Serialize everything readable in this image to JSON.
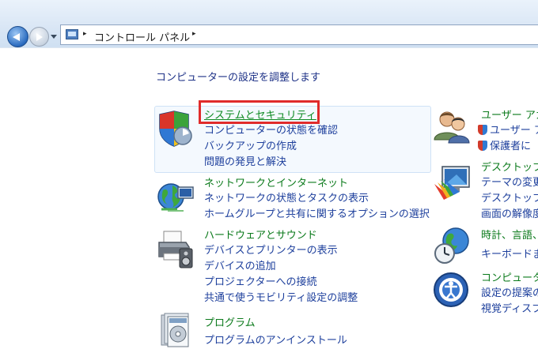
{
  "window": {
    "breadcrumb": "コントロール パネル",
    "breadcrumb_sep": "▸"
  },
  "main": {
    "heading": "コンピューターの設定を調整します",
    "left_categories": [
      {
        "title": "システムとセキュリティ",
        "icon": "shield-icon",
        "links": [
          "コンピューターの状態を確認",
          "バックアップの作成",
          "問題の発見と解決"
        ]
      },
      {
        "title": "ネットワークとインターネット",
        "icon": "network-globe-icon",
        "links": [
          "ネットワークの状態とタスクの表示",
          "ホームグループと共有に関するオプションの選択"
        ]
      },
      {
        "title": "ハードウェアとサウンド",
        "icon": "printer-icon",
        "links": [
          "デバイスとプリンターの表示",
          "デバイスの追加",
          "プロジェクターへの接続",
          "共通で使うモビリティ設定の調整"
        ]
      },
      {
        "title": "プログラム",
        "icon": "programs-icon",
        "links": [
          "プログラムのアンインストール"
        ]
      }
    ],
    "right_categories": [
      {
        "title": "ユーザー アカ",
        "icon": "users-icon",
        "links": [
          "ユーザー ア",
          "保護者に"
        ]
      },
      {
        "title": "デスクトップ",
        "icon": "desktop-icon",
        "links": [
          "テーマの変更",
          "デスクトップ",
          "画面の解像度"
        ]
      },
      {
        "title": "時計、言語、",
        "icon": "clock-globe-icon",
        "links": [
          "キーボードま"
        ]
      },
      {
        "title": "コンピュータ",
        "icon": "accessibility-icon",
        "links": [
          "設定の提案の",
          "視覚ディスプ"
        ]
      }
    ]
  }
}
